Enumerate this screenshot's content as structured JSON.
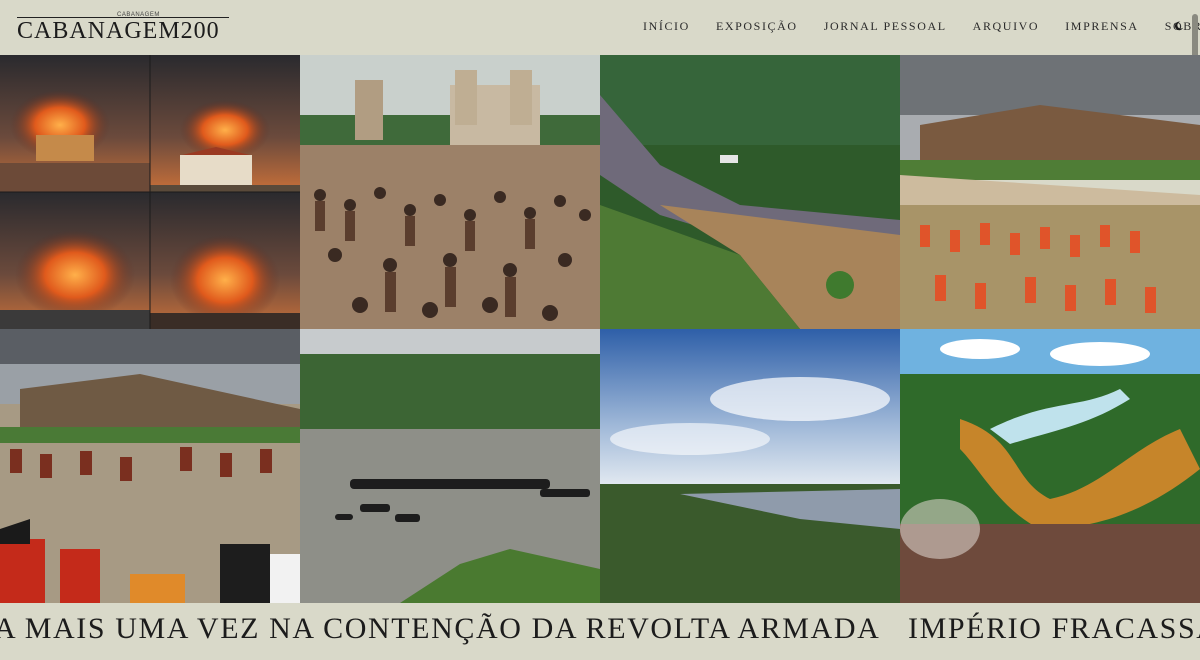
{
  "brand": {
    "logo_small": "CABANAGEM",
    "name": "CABANAGEM200"
  },
  "nav": {
    "items": [
      {
        "label": "INÍCIO"
      },
      {
        "label": "EXPOSIÇÃO"
      },
      {
        "label": "JORNAL PESSOAL"
      },
      {
        "label": "ARQUIVO"
      },
      {
        "label": "IMPRENSA"
      },
      {
        "label": "SOBRE"
      }
    ],
    "theme_icon": "moon-icon"
  },
  "gallery": {
    "tiles": [
      {
        "name": "fort-burning-storm-collage"
      },
      {
        "name": "crowd-before-cathedral"
      },
      {
        "name": "procession-forest-road"
      },
      {
        "name": "fort-with-red-uniformed-troops"
      },
      {
        "name": "fort-with-costumed-crowd"
      },
      {
        "name": "boats-crossing-river"
      },
      {
        "name": "amazon-river-aerial"
      },
      {
        "name": "forest-fire-crowd"
      }
    ]
  },
  "ticker": {
    "items": [
      "A MAIS UMA VEZ NA CONTENÇÃO DA REVOLTA ARMADA",
      "IMPÉRIO FRACASSA"
    ]
  },
  "colors": {
    "background": "#d9d9c9",
    "text": "#1c1c1c"
  }
}
